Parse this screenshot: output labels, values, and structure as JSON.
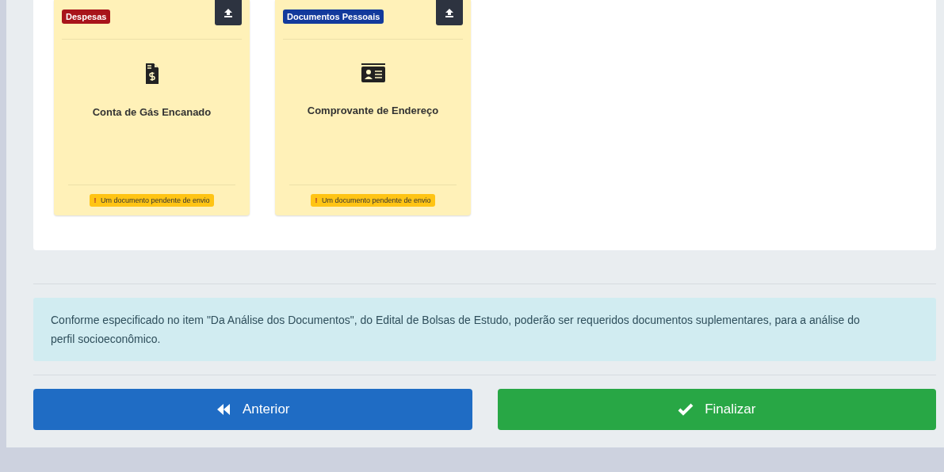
{
  "documents": [
    {
      "category": "Despesas",
      "color": "#a8141b",
      "kind": "invoice",
      "title": "Conta de Gás Encanado",
      "status": "Um documento pendente de envio",
      "status_mark": "!"
    },
    {
      "category": "Documentos Pessoais",
      "color": "#123a9c",
      "kind": "id-card",
      "title": "Comprovante de Endereço",
      "status": "Um documento pendente de envio",
      "status_mark": "!"
    }
  ],
  "notice": "Conforme especificado no item \"Da Análise dos Documentos\", do Edital de Bolsas de Estudo, poderão ser requeridos documentos suplementares, para a análise do perfil socioeconômico.",
  "buttons": [
    {
      "label": "Anterior",
      "kind": "previous"
    },
    {
      "label": "Finalizar",
      "kind": "finish"
    }
  ]
}
